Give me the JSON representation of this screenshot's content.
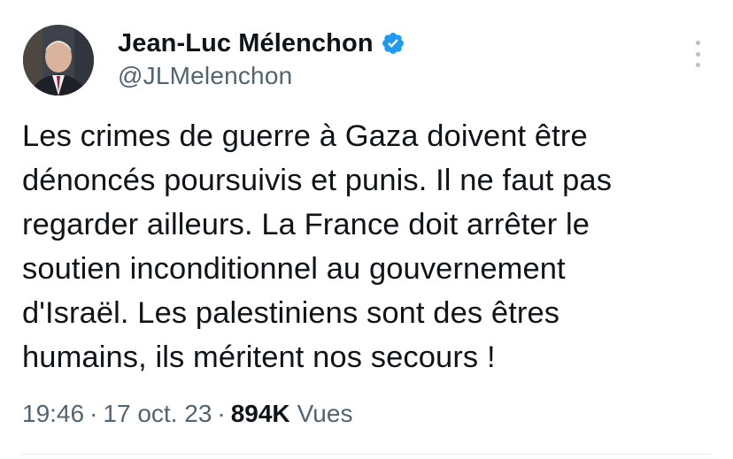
{
  "author": {
    "display_name": "Jean-Luc Mélenchon",
    "handle": "@JLMelenchon",
    "verified": true,
    "verified_color": "#1d9bf0"
  },
  "tweet": {
    "lines": [
      "Les crimes de guerre à Gaza doivent être",
      "dénoncés poursuivis et punis. Il ne faut pas",
      "regarder ailleurs. La France doit arrêter le",
      "soutien inconditionnel au gouvernement",
      "d'Israël. Les palestiniens sont des êtres",
      "humains, ils méritent nos secours !"
    ]
  },
  "meta": {
    "time": "19:46",
    "separator": "·",
    "date": "17 oct. 23",
    "views_count": "894K",
    "views_label": "Vues"
  },
  "icons": {
    "more": "more-vertical-icon",
    "verified": "verified-badge-icon"
  }
}
